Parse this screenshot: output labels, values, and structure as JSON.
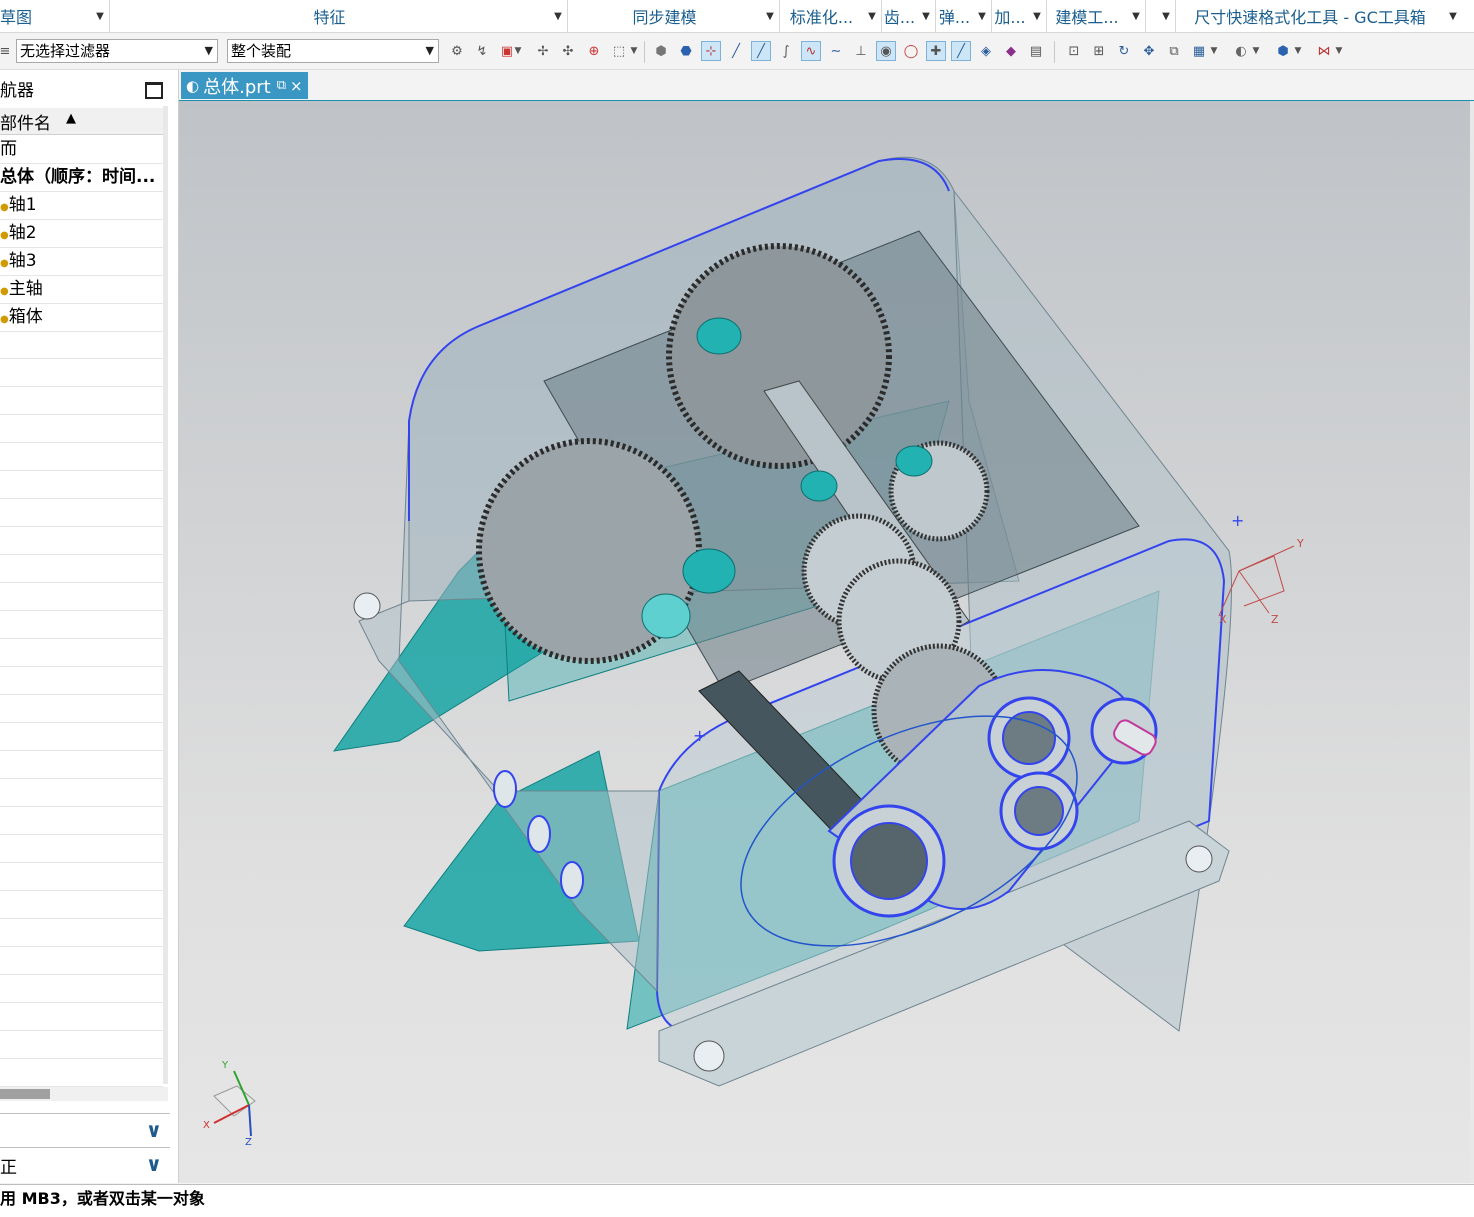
{
  "ribbon": {
    "groups": [
      {
        "label": "草图"
      },
      {
        "label": "特征"
      },
      {
        "label": "同步建模"
      },
      {
        "label": "标准化..."
      },
      {
        "label": "齿..."
      },
      {
        "label": "弹..."
      },
      {
        "label": "加..."
      },
      {
        "label": "建模工..."
      },
      {
        "label": ""
      },
      {
        "label": "尺寸快速格式化工具 - GC工具箱"
      }
    ]
  },
  "toolbar": {
    "selection_filter": "无选择过滤器",
    "assembly_scope": "整个装配"
  },
  "navigator": {
    "title": "航器",
    "column_header": "部件名",
    "rows": [
      {
        "label": "而",
        "bold": false
      },
      {
        "label": "总体（顺序：时间...",
        "bold": true
      },
      {
        "label": "轴1",
        "bold": false
      },
      {
        "label": "轴2",
        "bold": false
      },
      {
        "label": "轴3",
        "bold": false
      },
      {
        "label": "主轴",
        "bold": false
      },
      {
        "label": "箱体",
        "bold": false
      }
    ],
    "panel1_label": "",
    "panel2_label": "正"
  },
  "tab": {
    "label": "总体.prt",
    "close": "×"
  },
  "viewport": {
    "triad_labels": {
      "x": "X",
      "y": "Y",
      "z": "Z"
    },
    "csys_labels": {
      "x": "X",
      "y": "Y",
      "z": "Z"
    }
  },
  "status": {
    "message": "用 MB3，或者双击某一对象"
  },
  "colors": {
    "accent": "#3a97c4",
    "datum_plane": "#1aa8a8",
    "edge_highlight": "#3344ee"
  }
}
